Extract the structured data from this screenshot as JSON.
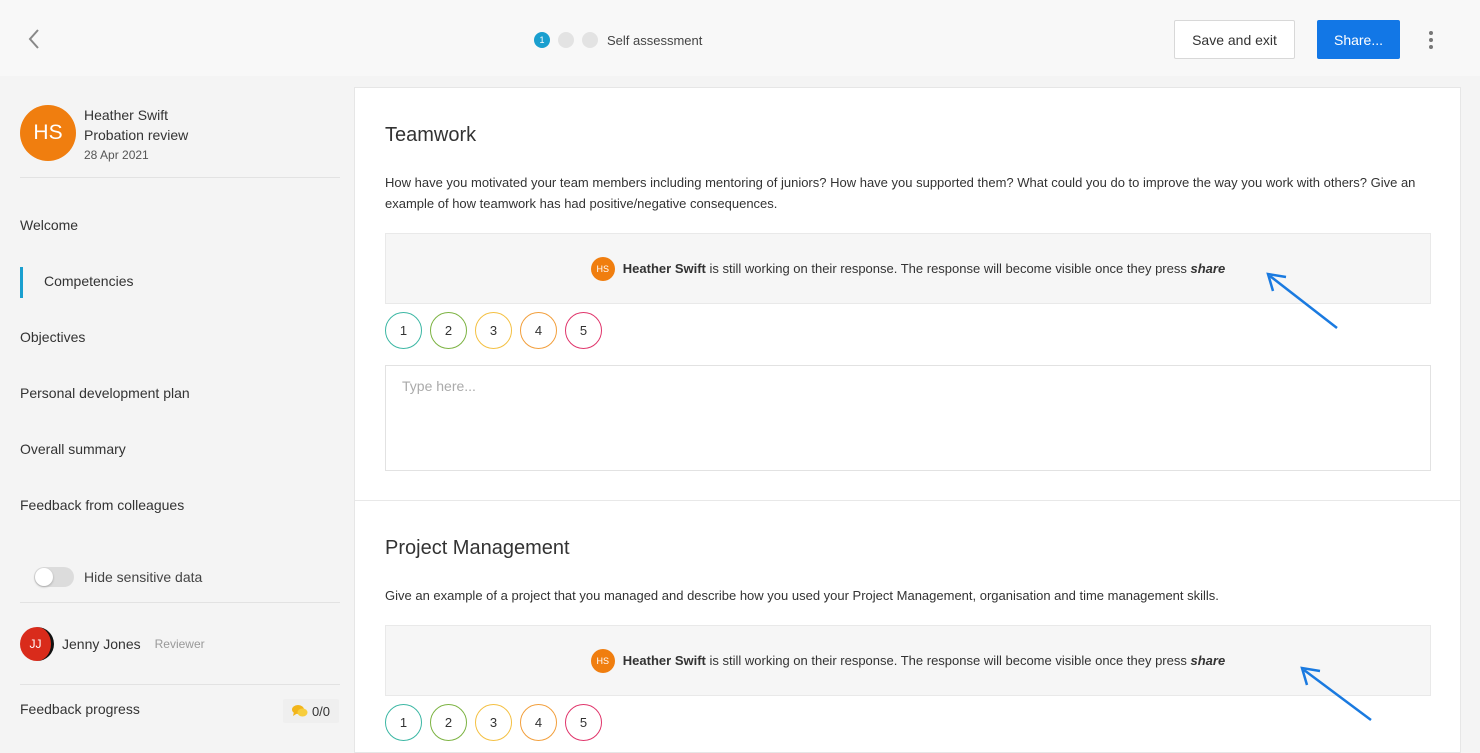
{
  "header": {
    "steps": [
      "1",
      "",
      ""
    ],
    "step_label": "Self assessment",
    "save_label": "Save and exit",
    "share_label": "Share..."
  },
  "sidebar": {
    "profile": {
      "initials": "HS",
      "name": "Heather Swift",
      "review": "Probation review",
      "date": "28 Apr 2021"
    },
    "nav": [
      {
        "label": "Welcome"
      },
      {
        "label": "Competencies",
        "active": true
      },
      {
        "label": "Objectives"
      },
      {
        "label": "Personal development plan"
      },
      {
        "label": "Overall summary"
      },
      {
        "label": "Feedback from colleagues"
      }
    ],
    "hide_sensitive_label": "Hide sensitive data",
    "reviewer": {
      "initials": "JJ",
      "name": "Jenny Jones",
      "role": "Reviewer"
    },
    "feedback_progress_label": "Feedback progress",
    "feedback_progress_value": "0/0"
  },
  "sections": [
    {
      "title": "Teamwork",
      "description": "How have you motivated your team members including mentoring of juniors? How have you supported them? What could you do to improve the way you work with others? Give an example of how teamwork has had positive/negative consequences.",
      "notice": {
        "initials": "HS",
        "name": "Heather Swift",
        "message": " is still working on their response. The response will become visible once they press ",
        "emphasis": "share"
      },
      "ratings": [
        "1",
        "2",
        "3",
        "4",
        "5"
      ],
      "placeholder": "Type here..."
    },
    {
      "title": "Project Management",
      "description": "Give an example of a project that you managed and describe how you used your Project Management, organisation and time management skills.",
      "notice": {
        "initials": "HS",
        "name": "Heather Swift",
        "message": " is still working on their response. The response will become visible once they press ",
        "emphasis": "share"
      },
      "ratings": [
        "1",
        "2",
        "3",
        "4",
        "5"
      ]
    }
  ],
  "colors": {
    "primary": "#1277e6",
    "accent": "#1a9fcf",
    "avatar_orange": "#f07e0f",
    "avatar_red": "#d92b1b",
    "arrow": "#1a7ae0",
    "rating_1": "#3cb7a4",
    "rating_2": "#7cb342",
    "rating_3": "#f4c042",
    "rating_4": "#f29f3c",
    "rating_5": "#e0356b"
  },
  "icons": {
    "back": "chevron-left-icon",
    "more": "kebab-icon",
    "feedback": "chat-bubbles-icon",
    "annotation": "arrow-icon"
  }
}
